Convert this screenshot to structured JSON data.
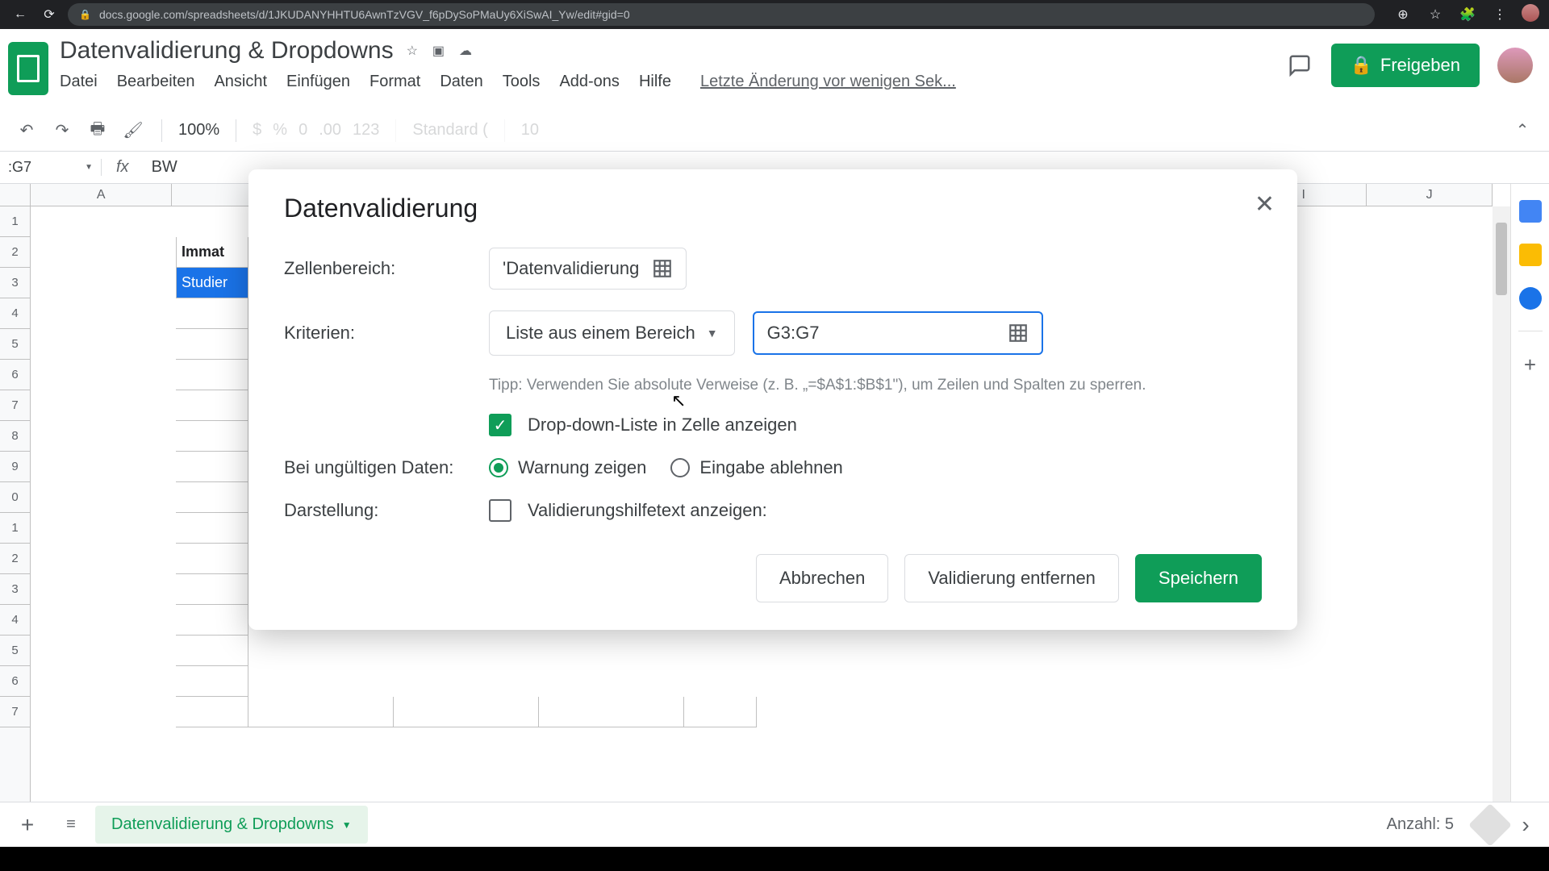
{
  "browser": {
    "url": "docs.google.com/spreadsheets/d/1JKUDANYHHTU6AwnTzVGV_f6pDySoPMaUy6XiSwAI_Yw/edit#gid=0"
  },
  "doc": {
    "title": "Datenvalidierung & Dropdowns",
    "last_edit": "Letzte Änderung vor wenigen Sek...",
    "share_label": "Freigeben"
  },
  "menus": {
    "file": "Datei",
    "edit": "Bearbeiten",
    "view": "Ansicht",
    "insert": "Einfügen",
    "format": "Format",
    "data": "Daten",
    "tools": "Tools",
    "addons": "Add-ons",
    "help": "Hilfe"
  },
  "toolbar": {
    "zoom": "100%",
    "dollar": "$",
    "percent": "%",
    "dec0": "0",
    "dec00": ".00",
    "num123": "123",
    "font": "Standard (",
    "fontsize": "10"
  },
  "formula": {
    "namebox": ":G7",
    "value": "BW"
  },
  "columns": {
    "A": "A",
    "I": "I",
    "J": "J"
  },
  "rows": {
    "r1": "1",
    "r2": "2",
    "r3": "3",
    "r4": "4",
    "r5": "5",
    "r6": "6",
    "r7": "7",
    "r8": "8",
    "r9": "9",
    "r10": "0",
    "r11": "1",
    "r12": "2",
    "r13": "3",
    "r14": "4",
    "r15": "5",
    "r16": "6",
    "r17": "7"
  },
  "cells": {
    "b2": "Immat",
    "b3": "Studier"
  },
  "dialog": {
    "title": "Datenvalidierung",
    "close": "✕",
    "range_label": "Zellenbereich:",
    "range_value": "'Datenvalidierung",
    "criteria_label": "Kriterien:",
    "criteria_select": "Liste aus einem Bereich",
    "criteria_range": "G3:G7",
    "tip": "Tipp: Verwenden Sie absolute Verweise (z. B. „=$A$1:$B$1\"), um Zeilen und Spalten zu sperren.",
    "show_dropdown": "Drop-down-Liste in Zelle anzeigen",
    "invalid_label": "Bei ungültigen Daten:",
    "warn": "Warnung zeigen",
    "reject": "Eingabe ablehnen",
    "appearance_label": "Darstellung:",
    "helptext": "Validierungshilfetext anzeigen:",
    "cancel": "Abbrechen",
    "remove": "Validierung entfernen",
    "save": "Speichern"
  },
  "tabs": {
    "sheet1": "Datenvalidierung & Dropdowns"
  },
  "status": {
    "count": "Anzahl: 5"
  }
}
